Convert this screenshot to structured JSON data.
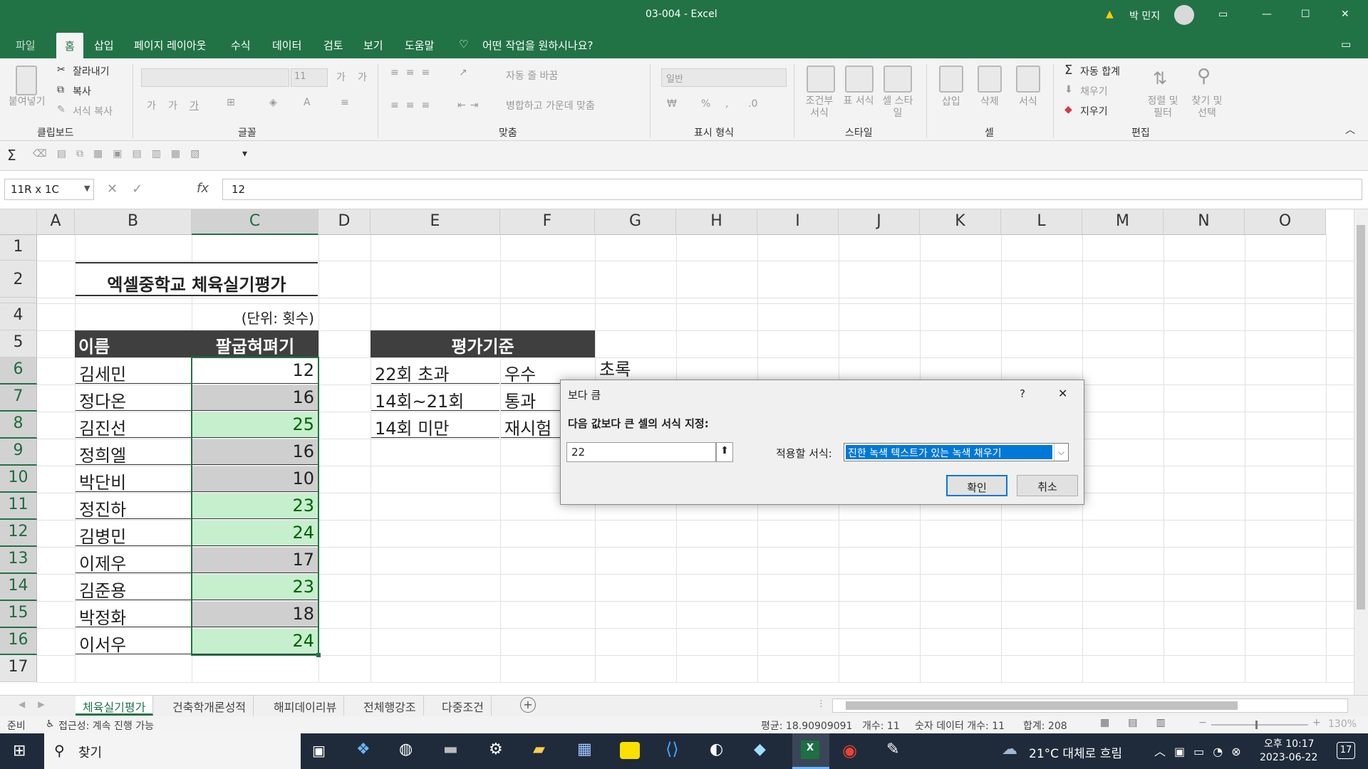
{
  "window": {
    "title": "03-004  -  Excel",
    "user": "박 민지"
  },
  "tabs": [
    "파일",
    "홈",
    "삽입",
    "페이지 레이아웃",
    "수식",
    "데이터",
    "검토",
    "보기",
    "도움말"
  ],
  "tell_me": "어떤 작업을 원하시나요?",
  "ribbon": {
    "clipboard": {
      "paste": "붙여넣기",
      "cut": "잘라내기",
      "copy": "복사",
      "format_painter": "서식 복사",
      "label": "클립보드"
    },
    "font": {
      "size": "11",
      "bold": "가",
      "italic": "가",
      "underline": "가",
      "grow": "가",
      "shrink": "가",
      "label": "글꼴"
    },
    "align": {
      "wrap": "자동 줄 바꿈",
      "merge": "병합하고 가운데 맞춤",
      "label": "맞춤"
    },
    "number": {
      "format": "일반",
      "percent": "%",
      "label": "표시 형식"
    },
    "styles": {
      "cond": "조건부 서식",
      "table": "표 서식",
      "cell": "셀 스타일",
      "label": "스타일"
    },
    "cells": {
      "insert": "삽입",
      "delete": "삭제",
      "format": "서식",
      "label": "셀"
    },
    "editing": {
      "autosum": "자동 합계",
      "fill": "채우기",
      "clear": "지우기",
      "sort": "정렬 및 필터",
      "find": "찾기 및 선택",
      "label": "편집"
    }
  },
  "formula": {
    "name_box": "11R x 1C",
    "value": "12"
  },
  "columns": [
    "A",
    "B",
    "C",
    "D",
    "E",
    "F",
    "G",
    "H",
    "I",
    "J",
    "K",
    "L",
    "M",
    "N",
    "O"
  ],
  "rows": [
    "1",
    "2",
    "4",
    "5",
    "6",
    "7",
    "8",
    "9",
    "10",
    "11",
    "12",
    "13",
    "14",
    "15",
    "16",
    "17"
  ],
  "sheet": {
    "title": "엑셀중학교 체육실기평가",
    "unit": "(단위: 횟수)",
    "header_name": "이름",
    "header_score": "팔굽혀펴기",
    "records": [
      {
        "name": "김세민",
        "score": "12",
        "hl": "none"
      },
      {
        "name": "정다온",
        "score": "16",
        "hl": "gray"
      },
      {
        "name": "김진선",
        "score": "25",
        "hl": "green"
      },
      {
        "name": "정희엘",
        "score": "16",
        "hl": "gray"
      },
      {
        "name": "박단비",
        "score": "10",
        "hl": "gray"
      },
      {
        "name": "정진하",
        "score": "23",
        "hl": "green"
      },
      {
        "name": "김병민",
        "score": "24",
        "hl": "green"
      },
      {
        "name": "이제우",
        "score": "17",
        "hl": "gray"
      },
      {
        "name": "김준용",
        "score": "23",
        "hl": "green"
      },
      {
        "name": "박정화",
        "score": "18",
        "hl": "gray"
      },
      {
        "name": "이서우",
        "score": "24",
        "hl": "green"
      }
    ],
    "criteria_header": "평가기준",
    "criteria": [
      {
        "range": "22회 초과",
        "grade": "우수",
        "color": "초록"
      },
      {
        "range": "14회~21회",
        "grade": "통과",
        "color": ""
      },
      {
        "range": "14회 미만",
        "grade": "재시험",
        "color": ""
      }
    ]
  },
  "sheet_tabs": [
    "체육실기평가",
    "건축학개론성적",
    "해피데이리뷰",
    "전체행강조",
    "다중조건"
  ],
  "status": {
    "ready": "준비",
    "access": "접근성: 계속 진행 가능",
    "avg": "평균: 18.90909091",
    "count": "개수: 11",
    "numcount": "숫자 데이터 개수: 11",
    "sum": "합계: 208",
    "zoom": "130%"
  },
  "dialog": {
    "title": "보다 큼",
    "help": "?",
    "close": "✕",
    "prompt": "다음 값보다 큰 셀의 서식 지정:",
    "value": "22",
    "format_label": "적용할 서식:",
    "format": "진한 녹색 텍스트가 있는 녹색 채우기",
    "ok": "확인",
    "cancel": "취소"
  },
  "taskbar": {
    "search": "찾기",
    "weather": "21°C 대체로 흐림",
    "ampm": "오후 10:17",
    "date": "2023-06-22",
    "notif": "17"
  }
}
